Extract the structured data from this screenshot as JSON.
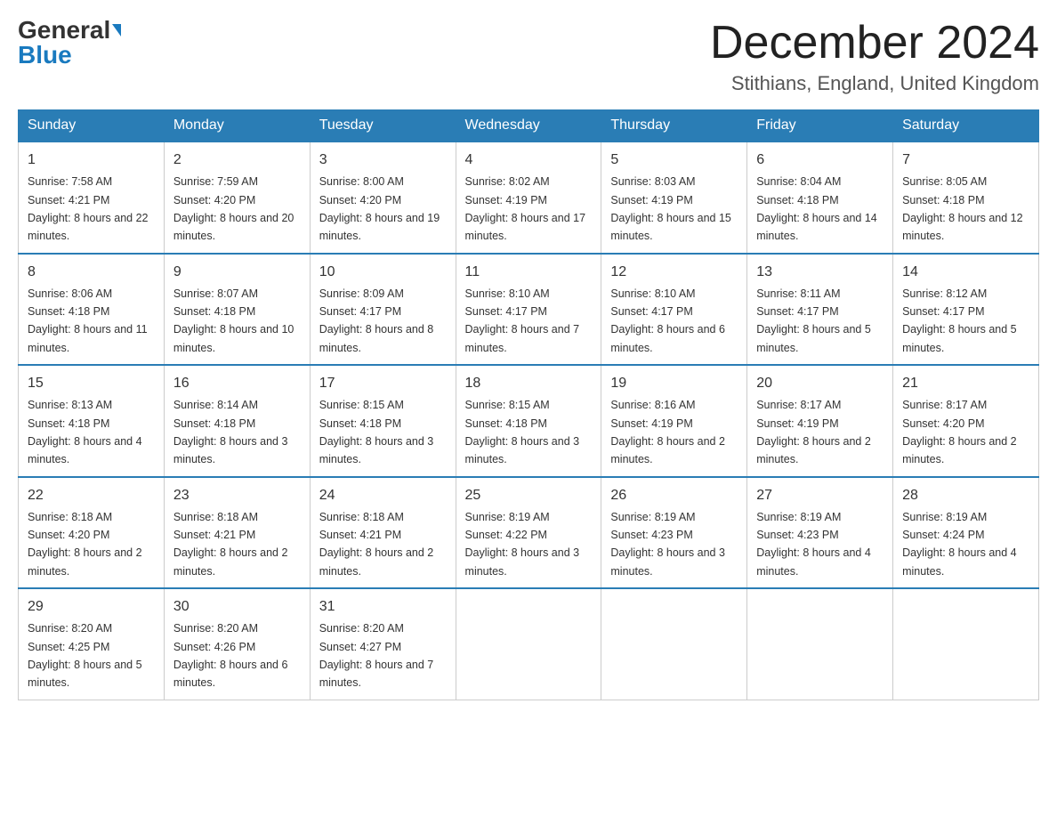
{
  "logo": {
    "general": "General",
    "blue": "Blue"
  },
  "header": {
    "month": "December 2024",
    "location": "Stithians, England, United Kingdom"
  },
  "days_of_week": [
    "Sunday",
    "Monday",
    "Tuesday",
    "Wednesday",
    "Thursday",
    "Friday",
    "Saturday"
  ],
  "weeks": [
    [
      {
        "day": "1",
        "sunrise": "7:58 AM",
        "sunset": "4:21 PM",
        "daylight": "8 hours and 22 minutes."
      },
      {
        "day": "2",
        "sunrise": "7:59 AM",
        "sunset": "4:20 PM",
        "daylight": "8 hours and 20 minutes."
      },
      {
        "day": "3",
        "sunrise": "8:00 AM",
        "sunset": "4:20 PM",
        "daylight": "8 hours and 19 minutes."
      },
      {
        "day": "4",
        "sunrise": "8:02 AM",
        "sunset": "4:19 PM",
        "daylight": "8 hours and 17 minutes."
      },
      {
        "day": "5",
        "sunrise": "8:03 AM",
        "sunset": "4:19 PM",
        "daylight": "8 hours and 15 minutes."
      },
      {
        "day": "6",
        "sunrise": "8:04 AM",
        "sunset": "4:18 PM",
        "daylight": "8 hours and 14 minutes."
      },
      {
        "day": "7",
        "sunrise": "8:05 AM",
        "sunset": "4:18 PM",
        "daylight": "8 hours and 12 minutes."
      }
    ],
    [
      {
        "day": "8",
        "sunrise": "8:06 AM",
        "sunset": "4:18 PM",
        "daylight": "8 hours and 11 minutes."
      },
      {
        "day": "9",
        "sunrise": "8:07 AM",
        "sunset": "4:18 PM",
        "daylight": "8 hours and 10 minutes."
      },
      {
        "day": "10",
        "sunrise": "8:09 AM",
        "sunset": "4:17 PM",
        "daylight": "8 hours and 8 minutes."
      },
      {
        "day": "11",
        "sunrise": "8:10 AM",
        "sunset": "4:17 PM",
        "daylight": "8 hours and 7 minutes."
      },
      {
        "day": "12",
        "sunrise": "8:10 AM",
        "sunset": "4:17 PM",
        "daylight": "8 hours and 6 minutes."
      },
      {
        "day": "13",
        "sunrise": "8:11 AM",
        "sunset": "4:17 PM",
        "daylight": "8 hours and 5 minutes."
      },
      {
        "day": "14",
        "sunrise": "8:12 AM",
        "sunset": "4:17 PM",
        "daylight": "8 hours and 5 minutes."
      }
    ],
    [
      {
        "day": "15",
        "sunrise": "8:13 AM",
        "sunset": "4:18 PM",
        "daylight": "8 hours and 4 minutes."
      },
      {
        "day": "16",
        "sunrise": "8:14 AM",
        "sunset": "4:18 PM",
        "daylight": "8 hours and 3 minutes."
      },
      {
        "day": "17",
        "sunrise": "8:15 AM",
        "sunset": "4:18 PM",
        "daylight": "8 hours and 3 minutes."
      },
      {
        "day": "18",
        "sunrise": "8:15 AM",
        "sunset": "4:18 PM",
        "daylight": "8 hours and 3 minutes."
      },
      {
        "day": "19",
        "sunrise": "8:16 AM",
        "sunset": "4:19 PM",
        "daylight": "8 hours and 2 minutes."
      },
      {
        "day": "20",
        "sunrise": "8:17 AM",
        "sunset": "4:19 PM",
        "daylight": "8 hours and 2 minutes."
      },
      {
        "day": "21",
        "sunrise": "8:17 AM",
        "sunset": "4:20 PM",
        "daylight": "8 hours and 2 minutes."
      }
    ],
    [
      {
        "day": "22",
        "sunrise": "8:18 AM",
        "sunset": "4:20 PM",
        "daylight": "8 hours and 2 minutes."
      },
      {
        "day": "23",
        "sunrise": "8:18 AM",
        "sunset": "4:21 PM",
        "daylight": "8 hours and 2 minutes."
      },
      {
        "day": "24",
        "sunrise": "8:18 AM",
        "sunset": "4:21 PM",
        "daylight": "8 hours and 2 minutes."
      },
      {
        "day": "25",
        "sunrise": "8:19 AM",
        "sunset": "4:22 PM",
        "daylight": "8 hours and 3 minutes."
      },
      {
        "day": "26",
        "sunrise": "8:19 AM",
        "sunset": "4:23 PM",
        "daylight": "8 hours and 3 minutes."
      },
      {
        "day": "27",
        "sunrise": "8:19 AM",
        "sunset": "4:23 PM",
        "daylight": "8 hours and 4 minutes."
      },
      {
        "day": "28",
        "sunrise": "8:19 AM",
        "sunset": "4:24 PM",
        "daylight": "8 hours and 4 minutes."
      }
    ],
    [
      {
        "day": "29",
        "sunrise": "8:20 AM",
        "sunset": "4:25 PM",
        "daylight": "8 hours and 5 minutes."
      },
      {
        "day": "30",
        "sunrise": "8:20 AM",
        "sunset": "4:26 PM",
        "daylight": "8 hours and 6 minutes."
      },
      {
        "day": "31",
        "sunrise": "8:20 AM",
        "sunset": "4:27 PM",
        "daylight": "8 hours and 7 minutes."
      },
      null,
      null,
      null,
      null
    ]
  ]
}
